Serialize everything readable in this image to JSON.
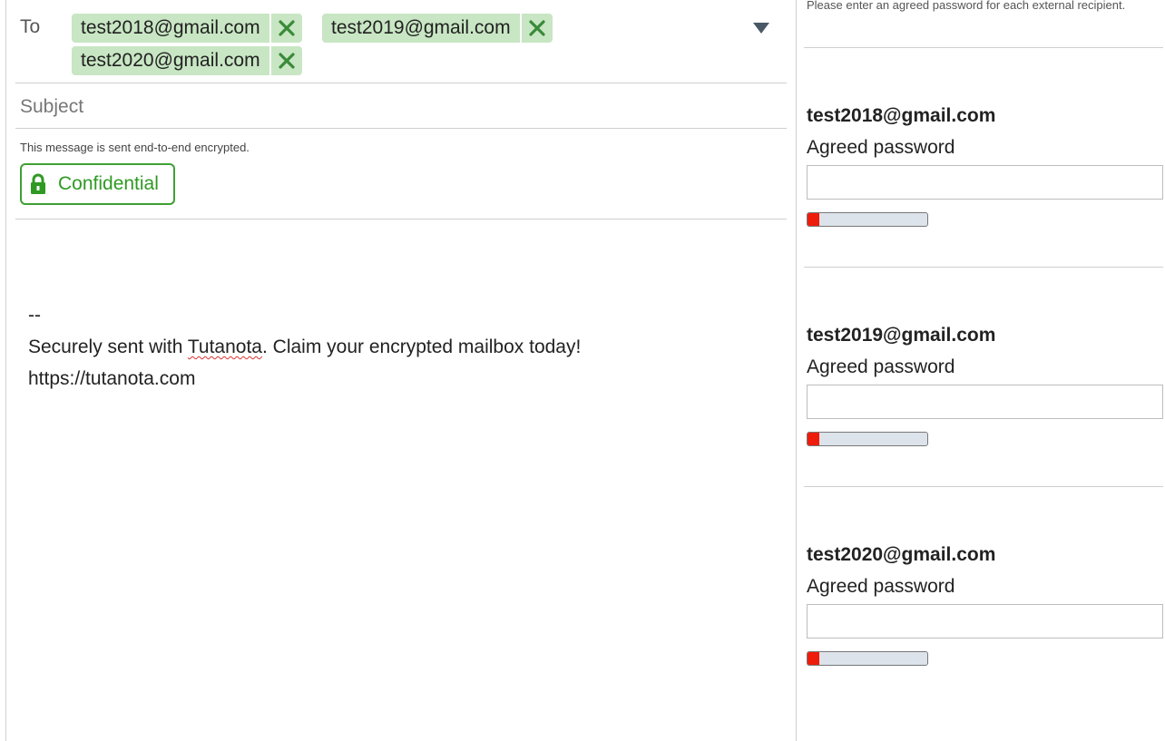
{
  "compose": {
    "to_label": "To",
    "recipients": [
      {
        "email": "test2018@gmail.com"
      },
      {
        "email": "test2019@gmail.com"
      },
      {
        "email": "test2020@gmail.com"
      }
    ],
    "subject_placeholder": "Subject",
    "encryption_note": "This message is sent end-to-end encrypted.",
    "confidential_label": "Confidential",
    "body_lines": [
      "--",
      "Securely sent with ",
      "Tutanota",
      ". Claim your encrypted mailbox today!",
      "https://tutanota.com"
    ]
  },
  "panel": {
    "hint": "Please enter an agreed password for each external recipient.",
    "password_label": "Agreed password",
    "entries": [
      {
        "email": "test2018@gmail.com",
        "strength": 0.1
      },
      {
        "email": "test2019@gmail.com",
        "strength": 0.1
      },
      {
        "email": "test2020@gmail.com",
        "strength": 0.1
      }
    ]
  },
  "colors": {
    "chip_bg": "#c8e6c3",
    "accent_green": "#2e9a22",
    "strength_red": "#ee1c0a"
  },
  "icons": {
    "remove": "close-icon",
    "dropdown": "triangle-down-icon",
    "lock": "lock-icon"
  }
}
